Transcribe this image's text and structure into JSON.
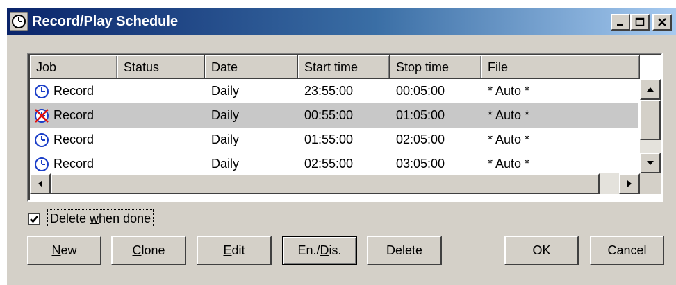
{
  "window": {
    "title": "Record/Play Schedule",
    "colors": {
      "title_start": "#0a246a",
      "title_end": "#a6caf0",
      "face": "#d4d0c8",
      "selected_row": "#c8c8c8"
    },
    "title_icon": "clock-app-icon",
    "title_buttons": [
      "minimize-icon",
      "maximize-icon",
      "close-icon"
    ]
  },
  "list": {
    "columns": [
      "Job",
      "Status",
      "Date",
      "Start time",
      "Stop time",
      "File"
    ],
    "rows": [
      {
        "icon": "clock-icon",
        "job": "Record",
        "status": "",
        "date": "Daily",
        "start": "23:55:00",
        "stop": "00:05:00",
        "file": "* Auto *",
        "selected": false
      },
      {
        "icon": "disabled-clock-icon",
        "job": "Record",
        "status": "",
        "date": "Daily",
        "start": "00:55:00",
        "stop": "01:05:00",
        "file": "* Auto *",
        "selected": true
      },
      {
        "icon": "clock-icon",
        "job": "Record",
        "status": "",
        "date": "Daily",
        "start": "01:55:00",
        "stop": "02:05:00",
        "file": "* Auto *",
        "selected": false
      },
      {
        "icon": "clock-icon",
        "job": "Record",
        "status": "",
        "date": "Daily",
        "start": "02:55:00",
        "stop": "03:05:00",
        "file": "* Auto *",
        "selected": false
      }
    ]
  },
  "delete_when_done": {
    "checked": true,
    "label_prefix": "Delete ",
    "label_mnemonic": "w",
    "label_suffix": "hen done"
  },
  "buttons": {
    "new": {
      "mn": "N",
      "rest": "ew"
    },
    "clone": {
      "mn": "C",
      "rest": "lone"
    },
    "edit": {
      "mn": "E",
      "rest": "dit"
    },
    "endis": {
      "pre": "En./",
      "mn": "D",
      "rest": "is."
    },
    "delete": "Delete",
    "ok": "OK",
    "cancel": "Cancel"
  }
}
